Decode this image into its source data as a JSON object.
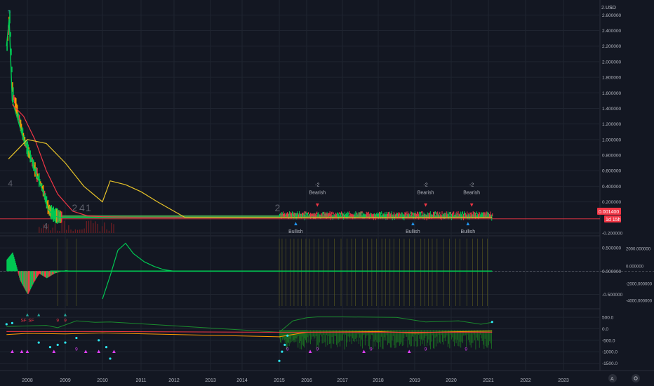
{
  "header": {
    "currency": "USD",
    "top_partial_tick": "2."
  },
  "price_tag": {
    "value": "0.001400",
    "countdown": "1d 15h"
  },
  "colors": {
    "background": "#131722",
    "grid": "#1f2430",
    "up": "#26a69a",
    "green": "#00c853",
    "red": "#f23645",
    "yellow": "#e6c229",
    "cyan": "#2ee6f0",
    "magenta": "#e040fb",
    "orange": "#ff9800",
    "blue": "#2962ff",
    "text": "#b2b5be"
  },
  "chart_data": [
    {
      "type": "line",
      "panel": "price",
      "y_ticks": [
        "2.600000",
        "2.400000",
        "2.200000",
        "2.000000",
        "1.800000",
        "1.600000",
        "1.400000",
        "1.200000",
        "1.000000",
        "0.800000",
        "0.600000",
        "0.400000",
        "0.200000",
        "-0.200000"
      ],
      "ylim": [
        -0.2,
        2.72
      ],
      "series": [
        {
          "x": [
            2007.45,
            2007.52,
            2007.6,
            2007.75,
            2007.9,
            2008.05,
            2008.2,
            2008.4,
            2008.55,
            2008.7,
            2008.85,
            2009.0,
            2009.5,
            2010.0,
            2012.0,
            2015.0,
            2021.1
          ],
          "values": [
            2.2,
            2.55,
            1.5,
            1.25,
            1.0,
            0.85,
            0.6,
            0.35,
            0.1,
            0.02,
            0.0,
            0.0,
            0.0,
            0.0,
            0.0,
            0.0,
            0.0
          ]
        },
        {
          "x": [
            2007.6,
            2007.9,
            2008.2,
            2008.5,
            2008.8,
            2009.2,
            2009.6,
            2010.0,
            2011.0,
            2012.0,
            2015.0,
            2021.1
          ],
          "values": [
            1.45,
            1.3,
            1.0,
            0.6,
            0.3,
            0.08,
            0.02,
            0.01,
            0.0,
            0.0,
            0.0,
            0.0
          ]
        },
        {
          "x": [
            2007.5,
            2008.0,
            2008.5,
            2009.0,
            2009.5,
            2010.0,
            2010.2,
            2010.6,
            2011.0,
            2011.5,
            2012.3,
            2015.0,
            2021.1
          ],
          "values": [
            0.75,
            1.0,
            0.95,
            0.7,
            0.4,
            0.2,
            0.47,
            0.42,
            0.33,
            0.2,
            0.0,
            0.0,
            0.0
          ]
        }
      ],
      "labels": [
        "5",
        "4",
        "4",
        "2",
        "4",
        "1",
        "2",
        "-2",
        "Bearish",
        "-2",
        "Bearish",
        "-2",
        "Bearish",
        "Bullish",
        "Bullish",
        "Bullish"
      ]
    },
    {
      "type": "area",
      "panel": "oscillator",
      "left_ticks": [
        "0.500000",
        "0.000000",
        "-0.500000"
      ],
      "right_ticks": [
        "2000.000000",
        "0.000000",
        "-2000.000000",
        "-4000.000000"
      ],
      "ylim": [
        -0.75,
        0.7
      ],
      "series": [
        {
          "x": [
            2007.45,
            2007.6,
            2007.8,
            2008.0,
            2008.15,
            2008.3,
            2008.5,
            2008.7,
            2009.0,
            2009.2,
            2021.1
          ],
          "values": [
            0.25,
            0.4,
            -0.2,
            -0.5,
            -0.25,
            -0.05,
            -0.15,
            -0.05,
            0.02,
            0.0,
            0.0
          ]
        },
        {
          "x": [
            2010.0,
            2010.2,
            2010.4,
            2010.6,
            2010.8,
            2011.1,
            2011.4,
            2011.7,
            2012.0,
            2021.1
          ],
          "values": [
            -0.6,
            -0.1,
            0.45,
            0.6,
            0.38,
            0.2,
            0.1,
            0.03,
            0.0,
            0.0
          ]
        }
      ]
    },
    {
      "type": "line",
      "panel": "lower",
      "y_ticks": [
        "500.0",
        "0.0",
        "-500.0",
        "-1000.0",
        "-1500.0"
      ],
      "ylim": [
        -1700,
        750
      ],
      "series": [
        {
          "x": [
            2007.45,
            2008.5,
            2008.8,
            2009.3,
            2009.8,
            2010.2,
            2015.0,
            2015.5,
            2016.0,
            2016.3,
            2017.0,
            2018.5,
            2019.3,
            2020.2,
            2020.8,
            2021.1
          ],
          "values": [
            100,
            150,
            50,
            350,
            280,
            300,
            -150,
            350,
            480,
            520,
            520,
            500,
            300,
            350,
            200,
            280
          ]
        },
        {
          "x": [
            2007.45,
            2008.0,
            2009.0,
            2010.0,
            2015.0,
            2016.0,
            2018.0,
            2019.0,
            2020.0,
            2021.1
          ],
          "values": [
            -250,
            -200,
            -220,
            -180,
            -350,
            -150,
            -120,
            -180,
            -130,
            -100
          ]
        },
        {
          "x": [
            2007.45,
            2010.0,
            2015.0,
            2021.1
          ],
          "values": [
            -120,
            -120,
            -150,
            -150
          ]
        }
      ],
      "labels": [
        "SF",
        "SF",
        "9",
        "9",
        "9",
        "9",
        "9",
        "9",
        "9",
        "9"
      ]
    }
  ],
  "x_axis": {
    "labels": [
      "2008",
      "2009",
      "2010",
      "2011",
      "2012",
      "2013",
      "2014",
      "2015",
      "2016",
      "2017",
      "2018",
      "2019",
      "2020",
      "2021",
      "2022",
      "2023"
    ],
    "years": [
      2008,
      2009,
      2010,
      2011,
      2012,
      2013,
      2014,
      2015,
      2016,
      2017,
      2018,
      2019,
      2020,
      2021,
      2022,
      2023
    ]
  },
  "corner_icons": [
    "auto-scale-icon",
    "settings-icon"
  ]
}
